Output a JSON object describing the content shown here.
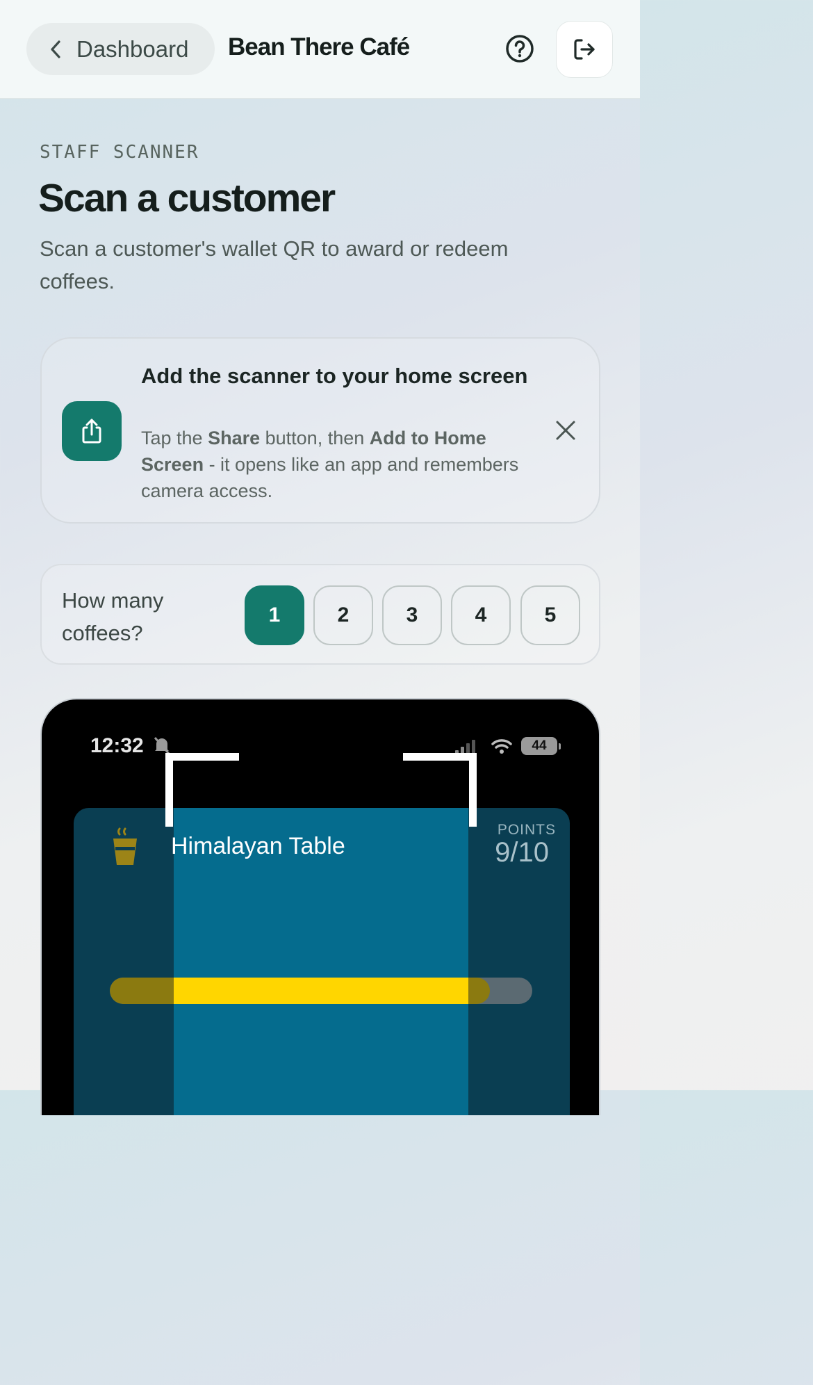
{
  "header": {
    "back_label": "Dashboard",
    "brand": "Bean There Café",
    "help_icon": "help-circle-icon",
    "logout_icon": "logout-icon"
  },
  "intro": {
    "eyebrow": "STAFF SCANNER",
    "title": "Scan a customer",
    "subtitle": "Scan a customer's wallet QR to award or redeem coffees."
  },
  "tip": {
    "title": "Add the scanner to your home screen",
    "body_prefix": "Tap the ",
    "share_word": "Share",
    "body_middle": " button, then ",
    "add_words": "Add to Home Screen",
    "body_suffix": " - it opens like an app and remembers camera access.",
    "icon": "share-icon",
    "close_icon": "close-icon"
  },
  "coffee_count": {
    "label": "How many coffees?",
    "options": [
      "1",
      "2",
      "3",
      "4",
      "5"
    ],
    "selected": "1",
    "accent": "#147a6c"
  },
  "camera": {
    "status_time": "12:32",
    "battery": "44",
    "pass": {
      "name": "Himalayan Table",
      "points_label": "POINTS",
      "points_value": "9/10",
      "progress": 0.9
    }
  }
}
